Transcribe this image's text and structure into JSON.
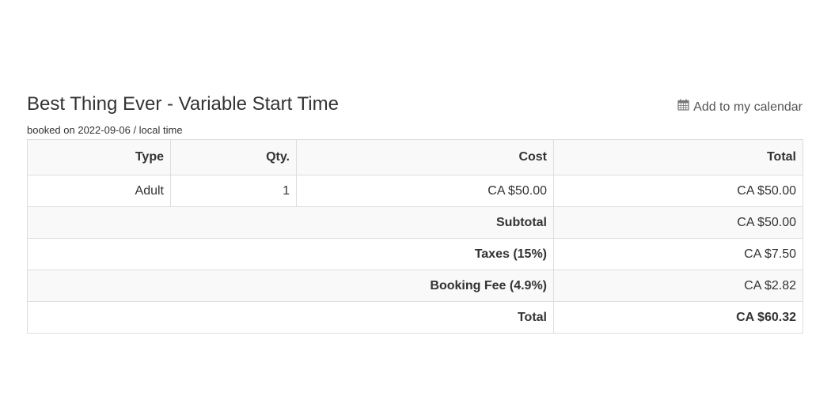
{
  "booking": {
    "title": "Best Thing Ever - Variable Start Time",
    "booked_on": "booked on 2022-09-06 / local time",
    "calendar_label": "Add to my calendar",
    "calendar_icon": "calendar-icon"
  },
  "table": {
    "headers": [
      "Type",
      "Qty.",
      "Cost",
      "Total"
    ],
    "rows": [
      {
        "type": "Adult",
        "qty": "1",
        "cost": "CA $50.00",
        "total": "CA $50.00"
      }
    ],
    "summary": [
      {
        "label": "Subtotal",
        "value": "CA $50.00"
      },
      {
        "label": "Taxes (15%)",
        "value": "CA $7.50"
      },
      {
        "label": "Booking Fee (4.9%)",
        "value": "CA $2.82"
      },
      {
        "label": "Total",
        "value": "CA $60.32"
      }
    ]
  },
  "colors": {
    "text": "#333333",
    "border": "#dddddd",
    "stripe": "#f9f9f9"
  }
}
